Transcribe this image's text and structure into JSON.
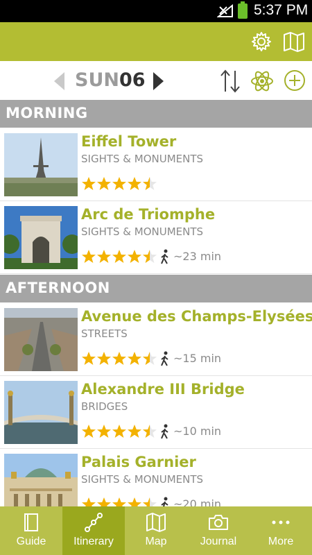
{
  "status_bar": {
    "time": "5:37 PM"
  },
  "day_selector": {
    "day": "SUN",
    "date": "06"
  },
  "colors": {
    "accent": "#b3bd33",
    "title_green": "#a4b12a",
    "section_gray": "#a5a5a5",
    "star": "#f3b200"
  },
  "sections": [
    {
      "label": "MORNING"
    },
    {
      "label": "AFTERNOON"
    }
  ],
  "items": [
    {
      "name": "Eiffel Tower",
      "category": "SIGHTS & MONUMENTS",
      "rating": 4.5,
      "walk": ""
    },
    {
      "name": "Arc de Triomphe",
      "category": "SIGHTS & MONUMENTS",
      "rating": 4.5,
      "walk": "~23 min"
    },
    {
      "name": "Avenue des Champs-Elysées",
      "category": "STREETS",
      "rating": 4.5,
      "walk": "~15 min"
    },
    {
      "name": "Alexandre III Bridge",
      "category": "BRIDGES",
      "rating": 4.5,
      "walk": "~10 min"
    },
    {
      "name": "Palais Garnier",
      "category": "SIGHTS & MONUMENTS",
      "rating": 4.5,
      "walk": "~20 min"
    }
  ],
  "tabs": [
    {
      "label": "Guide",
      "icon": "book-icon",
      "active": false
    },
    {
      "label": "Itinerary",
      "icon": "route-icon",
      "active": true
    },
    {
      "label": "Map",
      "icon": "map-icon",
      "active": false
    },
    {
      "label": "Journal",
      "icon": "camera-icon",
      "active": false
    },
    {
      "label": "More",
      "icon": "more-icon",
      "active": false
    }
  ]
}
